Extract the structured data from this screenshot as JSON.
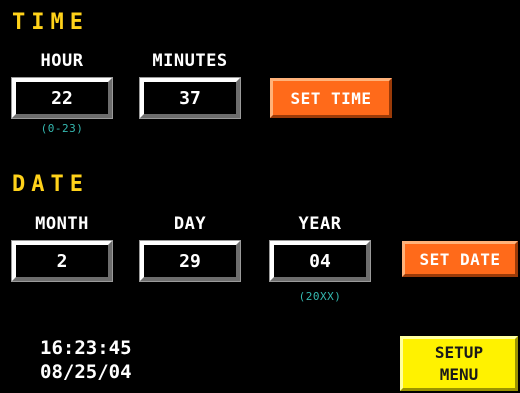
{
  "time_section": {
    "title": "TIME",
    "hour_label": "HOUR",
    "hour_value": "22",
    "hour_hint": "(0-23)",
    "minutes_label": "MINUTES",
    "minutes_value": "37",
    "set_time_label": "SET TIME"
  },
  "date_section": {
    "title": "DATE",
    "month_label": "MONTH",
    "month_value": "2",
    "day_label": "DAY",
    "day_value": "29",
    "year_label": "YEAR",
    "year_value": "04",
    "year_hint": "(20XX)",
    "set_date_label": "SET DATE"
  },
  "status": {
    "current_time": "16:23:45",
    "current_date": "08/25/04"
  },
  "setup_menu": {
    "line1": "SETUP",
    "line2": "MENU"
  },
  "colors": {
    "title_yellow": "#ffd21a",
    "button_orange": "#ff6a1a",
    "button_yellow": "#fff200",
    "hint_cyan": "#35b8b0"
  }
}
